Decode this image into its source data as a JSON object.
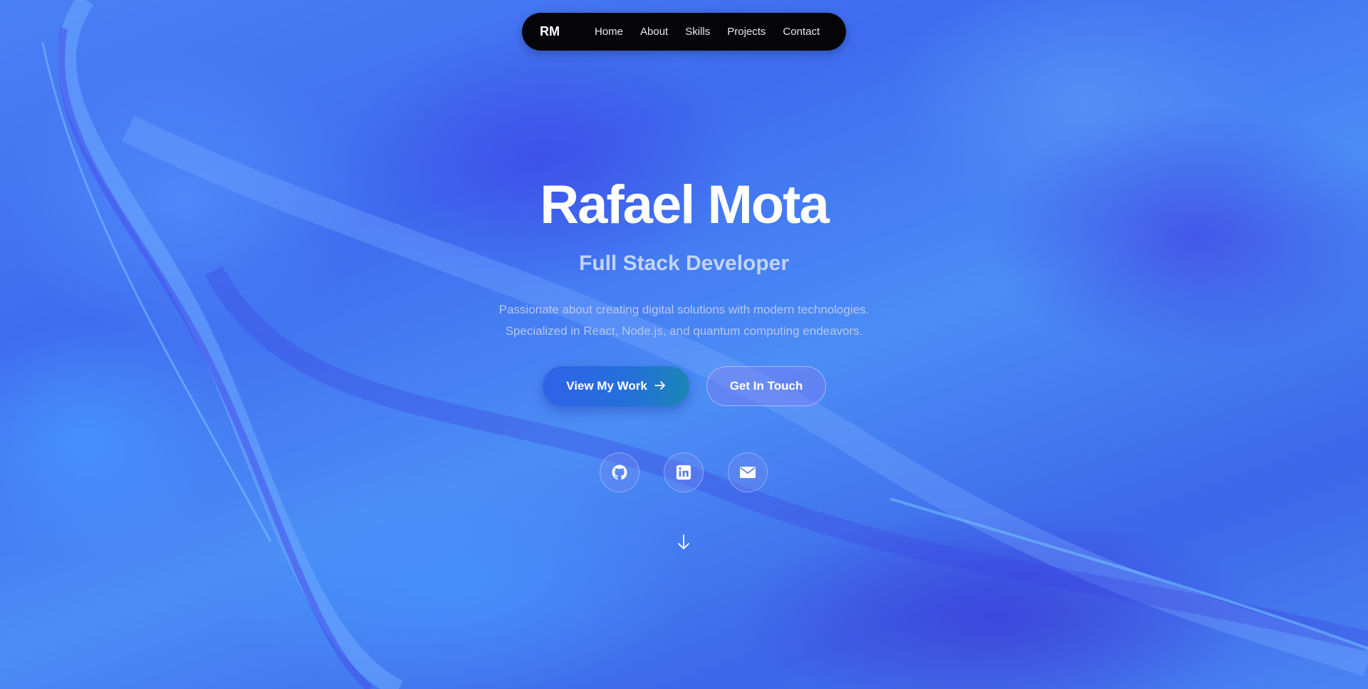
{
  "nav": {
    "logo": "RM",
    "links": [
      "Home",
      "About",
      "Skills",
      "Projects",
      "Contact"
    ]
  },
  "hero": {
    "name": "Rafael Mota",
    "role": "Full Stack Developer",
    "description_line1": "Passionate about creating digital solutions with modern technologies.",
    "description_line2": "Specialized in React, Node.js, and quantum computing endeavors.",
    "primary_button": "View My Work",
    "primary_button_icon": "arrow-right-icon",
    "secondary_button": "Get In Touch"
  },
  "social": {
    "icons": [
      "github-icon",
      "linkedin-icon",
      "mail-icon"
    ]
  },
  "scroll_indicator": {
    "icon": "arrow-down-icon"
  },
  "colors": {
    "background": "#4a86f0",
    "nav_background": "#050508",
    "primary_button_start": "#2f63ea",
    "primary_button_end": "#1b86b6",
    "title": "#ffffff",
    "subtitle": "#c3d4f8"
  }
}
